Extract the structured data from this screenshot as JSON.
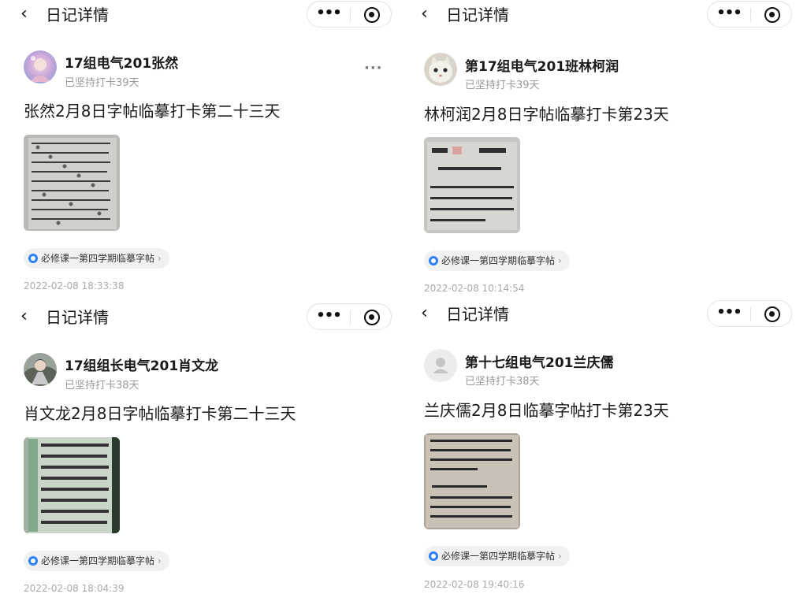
{
  "nav": {
    "back_glyph": "‹",
    "title": "日记详情",
    "more_glyph": "•••",
    "capsule_icons": [
      "more-icon",
      "target-close-icon"
    ]
  },
  "posts": [
    {
      "author": "17组电气201张然",
      "streak": "已坚持打卡39天",
      "text": "张然2月8日字帖临摹打卡第二十三天",
      "tag": "必修课一第四学期临摹字帖",
      "time": "2022-02-08 18:33:38",
      "more": "···"
    },
    {
      "author": "第17组电气201班林柯润",
      "streak": "已坚持打卡39天",
      "text": "林柯润2月8日字帖临摹打卡第23天",
      "tag": "必修课一第四学期临摹字帖",
      "time": "2022-02-08 10:14:54"
    },
    {
      "author": "17组组长电气201肖文龙",
      "streak": "已坚持打卡38天",
      "text": "肖文龙2月8日字帖临摹打卡第二十三天",
      "tag": "必修课一第四学期临摹字帖",
      "time": "2022-02-08 18:04:39"
    },
    {
      "author": "第十七组电气201兰庆儒",
      "streak": "已坚持打卡38天",
      "text": "兰庆儒2月8日临摹字帖打卡第23天",
      "tag": "必修课一第四学期临摹字帖",
      "time": "2022-02-08 19:40:16"
    }
  ],
  "colors": {
    "tag_icon": "#2d7ff9",
    "secondary_text": "#999999",
    "tag_bg": "#f1f1f1"
  }
}
